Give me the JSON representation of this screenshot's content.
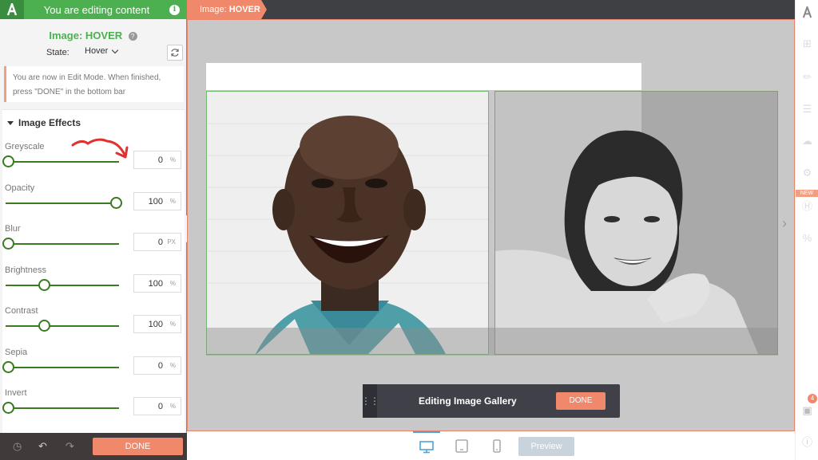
{
  "panel": {
    "header_title": "You are editing content",
    "element_title": "Image: HOVER",
    "state_label": "State:",
    "state_value": "Hover",
    "edit_notice_line1": "You are now in Edit Mode. When finished,",
    "edit_notice_line2": "press \"DONE\" in the bottom bar",
    "effects_title": "Image Effects",
    "effects": [
      {
        "label": "Greyscale",
        "value": "0",
        "unit": "%",
        "level": 0
      },
      {
        "label": "Opacity",
        "value": "100",
        "unit": "%",
        "level": 1
      },
      {
        "label": "Blur",
        "value": "0",
        "unit": "PX",
        "level": 0
      },
      {
        "label": "Brightness",
        "value": "100",
        "unit": "%",
        "level": 0.33
      },
      {
        "label": "Contrast",
        "value": "100",
        "unit": "%",
        "level": 0.33
      },
      {
        "label": "Sepia",
        "value": "0",
        "unit": "%",
        "level": 0
      },
      {
        "label": "Invert",
        "value": "0",
        "unit": "%",
        "level": 0
      }
    ],
    "done_label": "DONE"
  },
  "top_bar": {
    "breadcrumb_prefix": "Image:",
    "breadcrumb_state": "HOVER"
  },
  "canvas": {
    "editing_label": "Editing Image Gallery",
    "done_label": "DONE"
  },
  "device_bar": {
    "devices": [
      "desktop-icon",
      "tablet-icon",
      "mobile-icon"
    ],
    "active_device": "desktop-icon",
    "preview_label": "Preview"
  },
  "right_rail": {
    "new_badge": "NEW",
    "notification_count": "4"
  },
  "colors": {
    "brand_green": "#4caf50",
    "accent_orange": "#f0886b",
    "slider_green": "#3a7a22"
  }
}
